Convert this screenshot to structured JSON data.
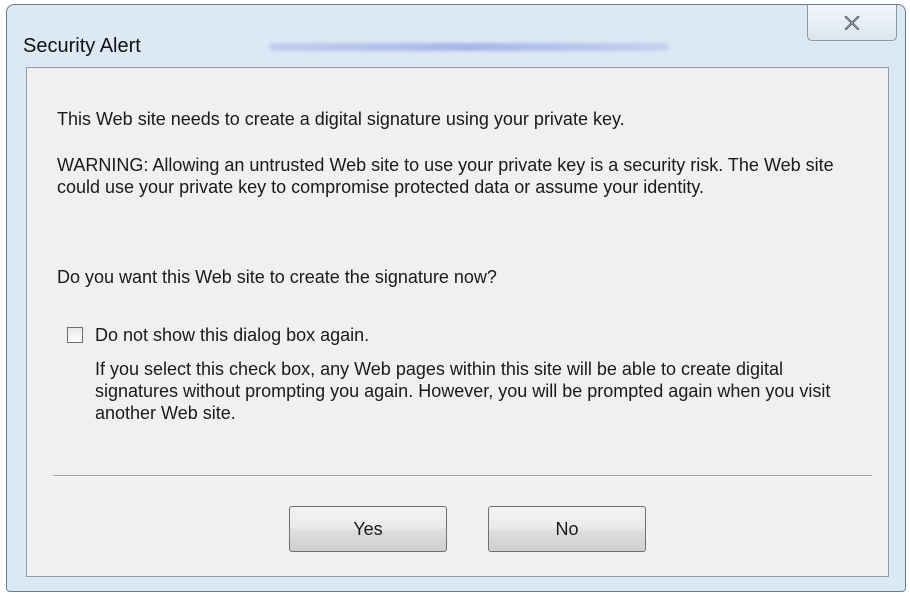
{
  "window": {
    "title": "Security Alert",
    "close_icon": "close-icon"
  },
  "message": {
    "intro": "This Web site needs to create a digital signature using your private key.",
    "warning": "WARNING: Allowing an untrusted Web site to use your private key is a security risk. The Web site could use your private key to compromise protected data or assume your identity.",
    "question": "Do you want this Web site to create the signature now?"
  },
  "checkbox": {
    "label": "Do not show this dialog box again.",
    "checked": false,
    "help": "If you select this check box, any Web pages within this site will be able to create digital signatures without prompting you again. However, you will be prompted again when you visit another Web site."
  },
  "buttons": {
    "yes": "Yes",
    "no": "No"
  }
}
